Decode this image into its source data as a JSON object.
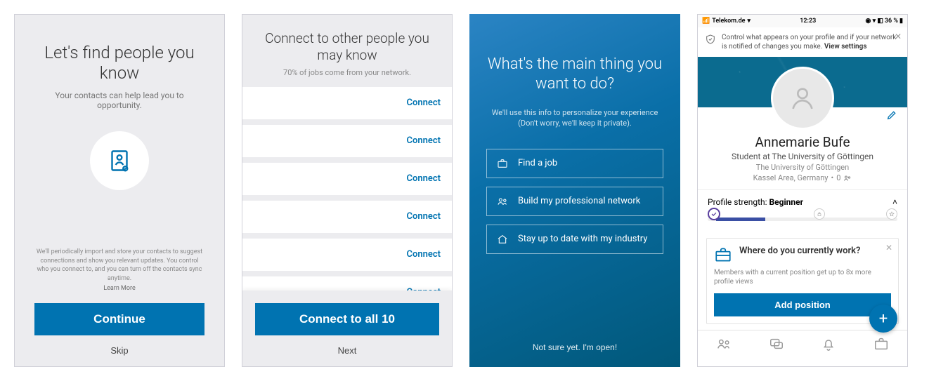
{
  "screen1": {
    "title": "Let's find people you know",
    "subtitle": "Your contacts can help lead you to opportunity.",
    "disclaimer": "We'll periodically import and store your contacts to suggest connections and show you relevant updates. You control who you connect to, and you can turn off the contacts sync anytime.",
    "learn_more": "Learn More",
    "continue_label": "Continue",
    "skip_label": "Skip"
  },
  "screen2": {
    "title": "Connect to other people you may know",
    "subtitle": "70% of jobs come from your network.",
    "connect_label": "Connect",
    "connect_all_label": "Connect to all 10",
    "next_label": "Next"
  },
  "screen3": {
    "title": "What's the main thing you want to do?",
    "subtitle": "We'll use this info to personalize your experience (Don't worry, we'll keep it private).",
    "option_job": "Find a job",
    "option_network": "Build my professional network",
    "option_industry": "Stay up to date with my industry",
    "not_sure": "Not sure yet. I'm open!"
  },
  "screen4": {
    "status_carrier": "Telekom.de",
    "status_time": "12:23",
    "status_battery": "36 %",
    "banner_text": "Control what appears on your profile and if your network is notified of changes you make. ",
    "banner_view_settings": "View settings",
    "name": "Annemarie Bufe",
    "role": "Student at The University of Göttingen",
    "university": "The University of Göttingen",
    "location": "Kassel Area, Germany",
    "connections": "0",
    "strength_prefix": "Profile strength: ",
    "strength_level": "Beginner",
    "card_title": "Where do you currently work?",
    "card_sub": "Members with a current position get up to 8x more profile views",
    "add_position_label": "Add position"
  }
}
